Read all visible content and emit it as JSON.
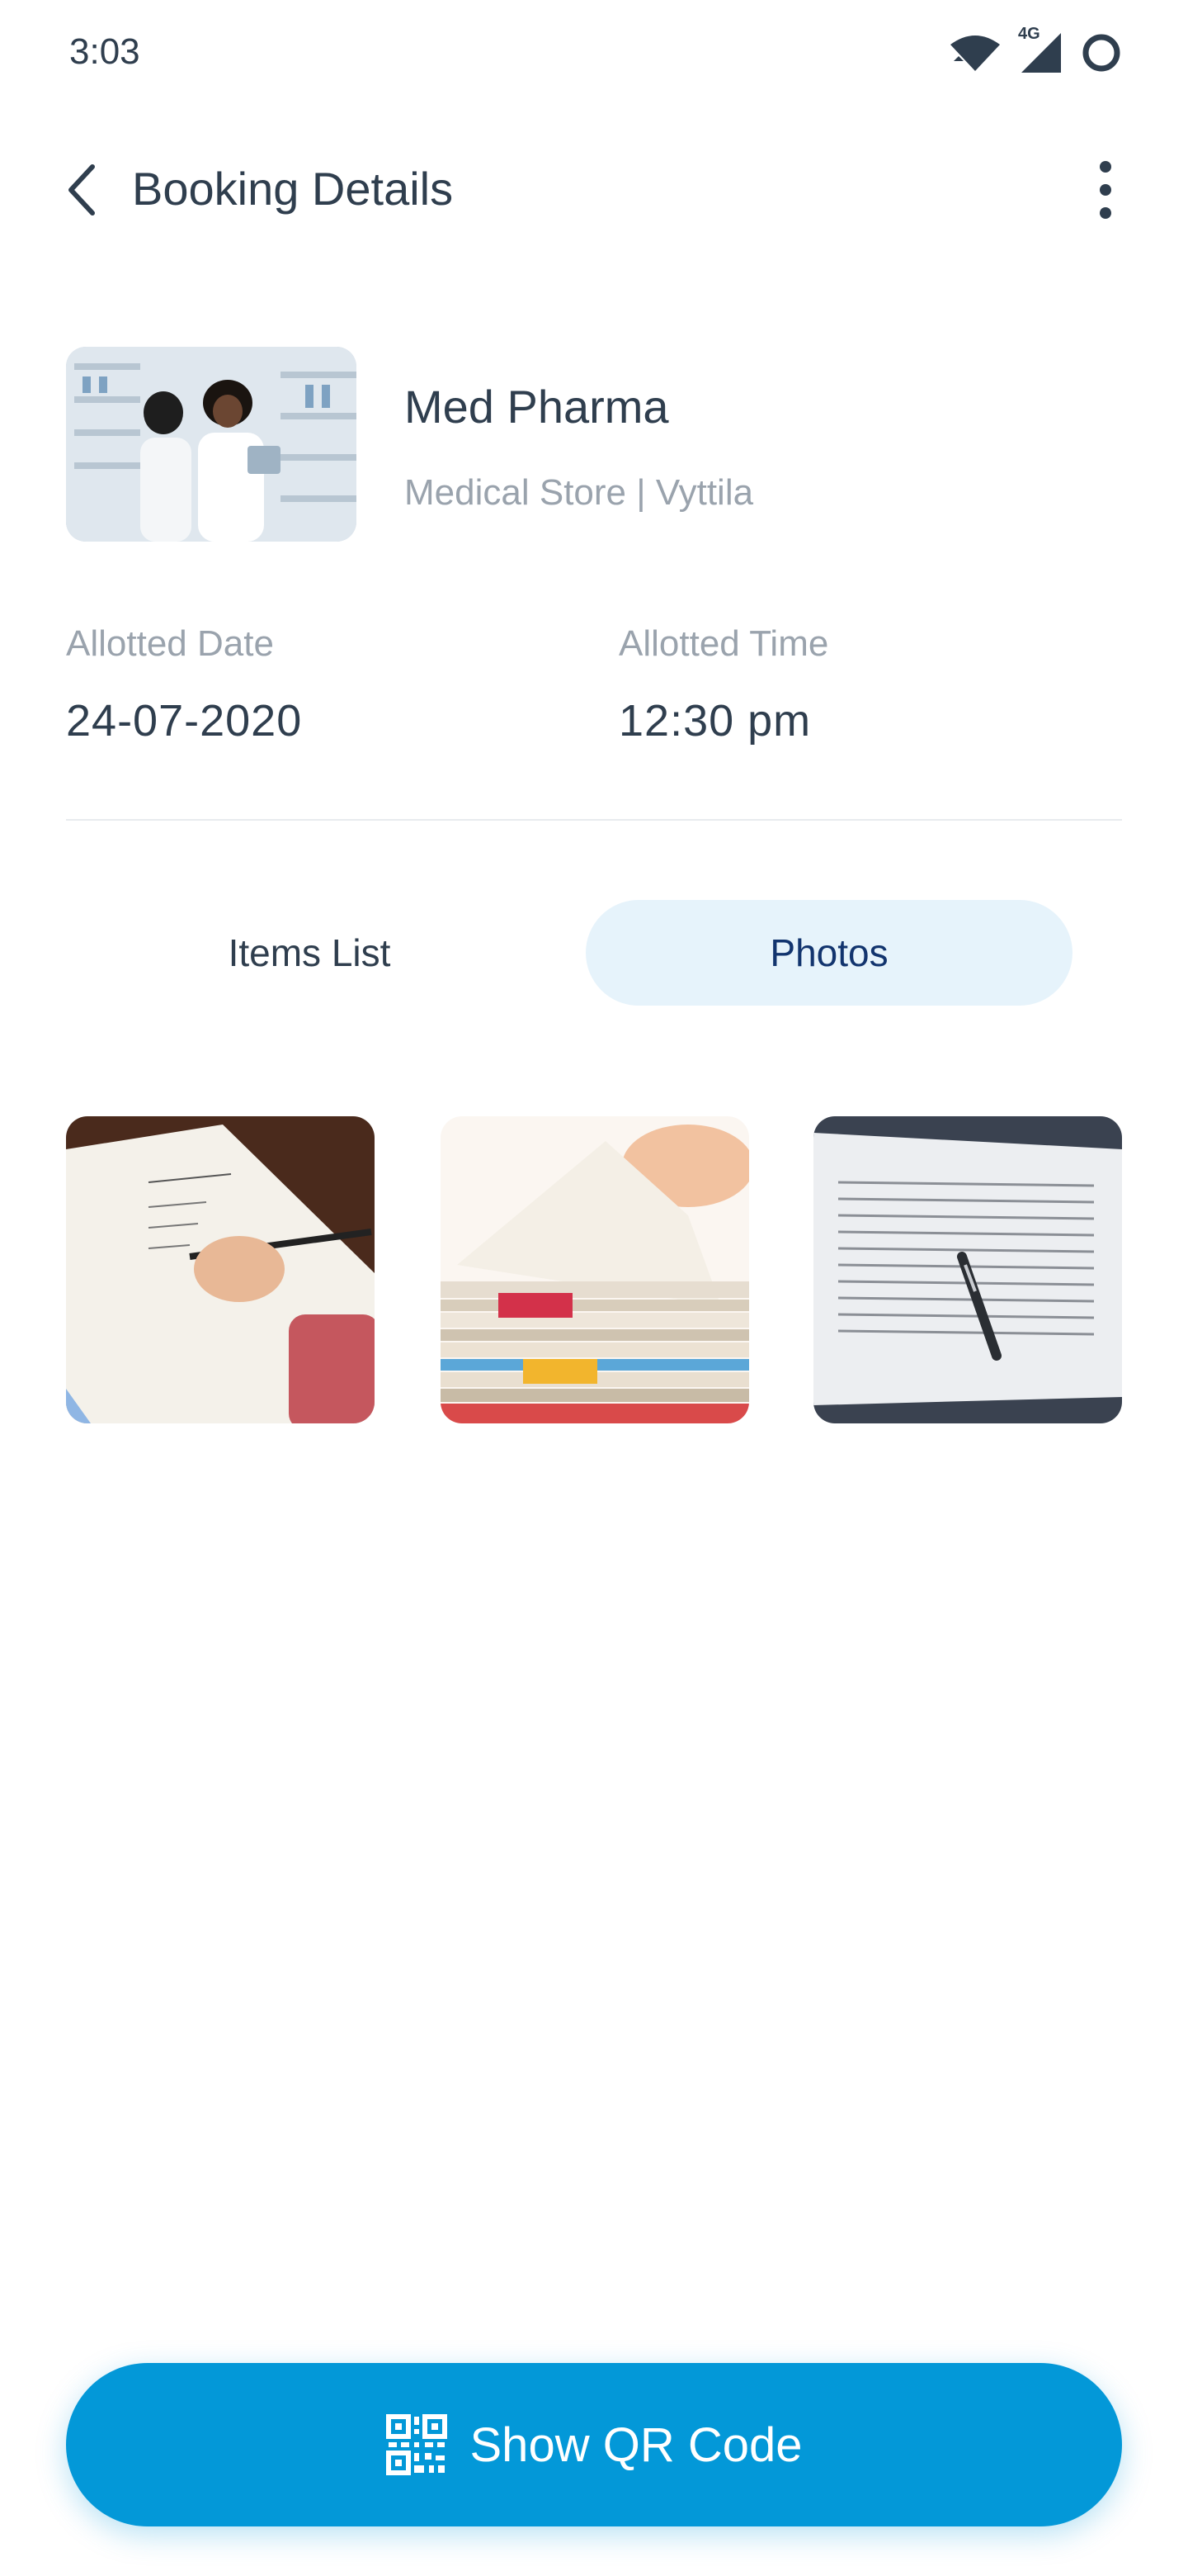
{
  "status_bar": {
    "time": "3:03",
    "network_label": "4G",
    "icons": [
      "wifi-icon",
      "cellular-signal-icon",
      "battery-ring-icon"
    ]
  },
  "header": {
    "title": "Booking Details",
    "back_icon": "chevron-left-icon",
    "menu_icon": "more-vertical-icon"
  },
  "store": {
    "name": "Med Pharma",
    "subtitle": "Medical Store | Vyttila",
    "image": "pharmacy-photo"
  },
  "booking": {
    "date_label": "Allotted Date",
    "date_value": "24-07-2020",
    "time_label": "Allotted Time",
    "time_value": "12:30 pm"
  },
  "tabs": [
    {
      "label": "Items List",
      "selected": false
    },
    {
      "label": "Photos",
      "selected": true
    }
  ],
  "photos": [
    "notebook-writing-photo",
    "paper-stack-photo",
    "contract-pen-photo"
  ],
  "qr_button": {
    "label": "Show QR Code",
    "icon": "qr-code-icon"
  },
  "colors": {
    "primary": "#0398d8",
    "tab_selected_bg": "#e6f3fb",
    "tab_selected_text": "#12346e",
    "text_primary": "#2f3e4e",
    "text_secondary": "#9aa3ad"
  }
}
